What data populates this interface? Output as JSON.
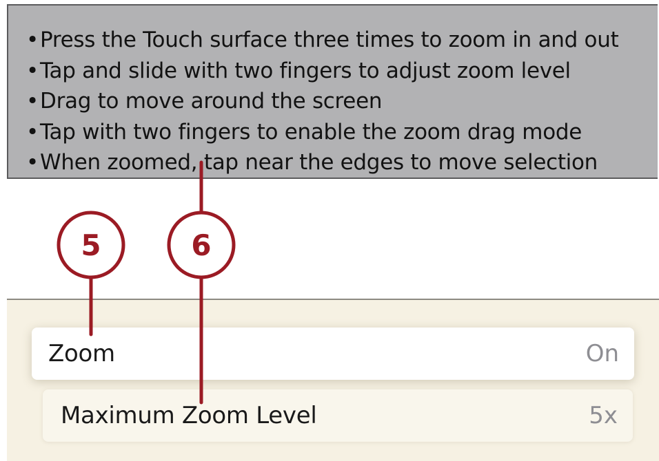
{
  "tips": {
    "items": [
      "Press the Touch surface three times to zoom in and out",
      "Tap and slide with two fingers to adjust zoom level",
      "Drag to move around the screen",
      "Tap with two fingers to enable the zoom drag mode",
      "When zoomed, tap near the edges to move selection"
    ]
  },
  "settings": {
    "zoom": {
      "label": "Zoom",
      "value": "On"
    },
    "max_zoom_level": {
      "label": "Maximum Zoom Level",
      "value": "5x"
    }
  },
  "callouts": {
    "first": "5",
    "second": "6"
  },
  "colors": {
    "callout_accent": "#9b1b24",
    "tip_panel_bg": "#b2b2b4",
    "settings_bg": "#f6f1e3"
  }
}
